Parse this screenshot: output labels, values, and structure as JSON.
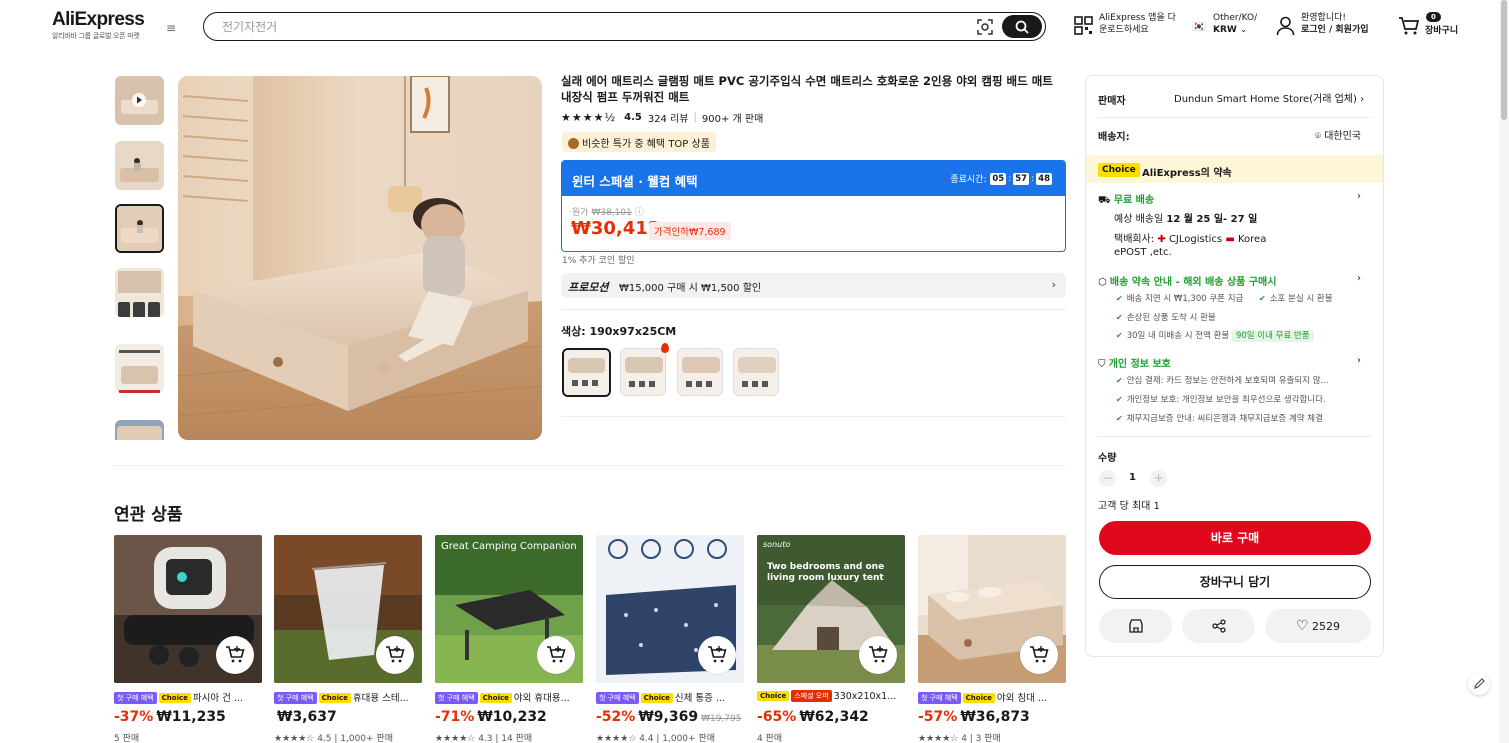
{
  "header": {
    "logo": "AliExpress",
    "logo_sub": "알리바바 그룹 글로벌 오픈 마켓",
    "search_placeholder": "전기자전거",
    "app_line1": "AliExpress 앱을 다",
    "app_line2": "운로드하세요",
    "region_line1": "Other/KO/",
    "region_line2": "KRW",
    "welcome": "환영합니다!",
    "login": "로그인 / 회원가입",
    "cart_count": "0",
    "cart_label": "장바구니"
  },
  "product": {
    "title": "실래 에어 매트리스 글램핑 매트 PVC 공기주입식 수면 매트리스 호화로운 2인용 야외 캠핑 배드 매트 내장식 펌프 두꺼워진 매트",
    "rating": "4.5",
    "reviews": "324 리뷰",
    "sold": "900+ 개 판매",
    "deal_badge": "비슷한 특가 중 혜택 TOP 상품",
    "sale_title": "윈터 스페셜 · 웰컴 혜택",
    "timer_label": "종료시간:",
    "timer_h": "05",
    "timer_m": "57",
    "timer_s": "48",
    "orig_label": "원가",
    "orig_price": "₩38,101",
    "price": "₩30,412",
    "discount": "가격인하₩7,689",
    "coin_note": "1% 추가 코인 할인",
    "promo_title": "프로모션",
    "promo_text": "₩15,000 구매 시 ₩1,500 할인",
    "color_label": "색상: 190x97x25CM"
  },
  "panel": {
    "seller_label": "판매자",
    "seller_name": "Dundun Smart Home Store(거래 업체)",
    "ship_to_label": "배송지:",
    "ship_to": "대한민국",
    "choice_badge": "Choice",
    "promise": "AliExpress의 약속",
    "free_ship": "무료 배송",
    "delivery_est_prefix": "예상 배송일",
    "delivery_date": "12 월 25 일- 27 일",
    "carrier_label": "택배회사:",
    "carrier_1": "CJLogistics",
    "carrier_2": "Korea",
    "carrier_3": "ePOST ,etc.",
    "promise_title": "배송 약속 안내 - 해외 배송 상품 구매시",
    "promise_1": "배송 지연 시 ₩1,300 쿠폰 지급",
    "promise_2": "소포 분실 시 환불",
    "promise_3": "손상된 상품 도착 시 환불",
    "promise_4": "30일 내 미배송 시 전액 환불",
    "promise_5": "90일 이내 무료 반품",
    "privacy_title": "개인 정보 보호",
    "privacy_1": "안심 결제: 카드 정보는 안전하게 보호되며 유출되지 않...",
    "privacy_2": "개인정보 보호: 개인정보 보안을 최우선으로 생각합니다.",
    "privacy_3": "채무지급보증 안내: 씨티은행과 채무지급보증 계약 체결",
    "qty_label": "수량",
    "qty": "1",
    "max_note": "고객 당 최대 1",
    "buy_now": "바로 구매",
    "add_cart": "장바구니 담기",
    "wish_count": "2529"
  },
  "related": {
    "title": "연관 상품",
    "tag_first": "첫 구매 혜택",
    "tag_choice": "Choice",
    "tag_sale": "스페셜 오퍼",
    "items": [
      {
        "name": "파시아 건 ...",
        "disc": "-37%",
        "price": "₩11,235",
        "old": "",
        "meta": "5 판매"
      },
      {
        "name": "휴대용 스테...",
        "disc": "",
        "price": "₩3,637",
        "old": "",
        "meta": "★★★★☆ 4.5 | 1,000+ 판매"
      },
      {
        "name": "야외 휴대용...",
        "disc": "-71%",
        "price": "₩10,232",
        "old": "",
        "meta": "★★★★☆ 4.3 | 14 판매"
      },
      {
        "name": "신체 통증 ...",
        "disc": "-52%",
        "price": "₩9,369",
        "old": "₩19,795",
        "meta": "★★★★☆ 4.4 | 1,000+ 판매"
      },
      {
        "name": "330x210x1...",
        "disc": "-65%",
        "price": "₩62,342",
        "old": "",
        "meta": "4 판매"
      },
      {
        "name": "야외 침대 ...",
        "disc": "-57%",
        "price": "₩36,873",
        "old": "",
        "meta": "★★★★☆ 4 | 3 판매"
      }
    ],
    "img_text_3": "Great Camping Companion",
    "img_text_5a": "sonuto",
    "img_text_5b": "Two bedrooms and one",
    "img_text_5c": "living room luxury tent"
  },
  "colors": {
    "accent_red": "#e62e04",
    "buy_red": "#e0081b",
    "sale_blue": "#1a73e8",
    "choice_yellow": "#ffdd00",
    "green": "#1f9e2f"
  }
}
